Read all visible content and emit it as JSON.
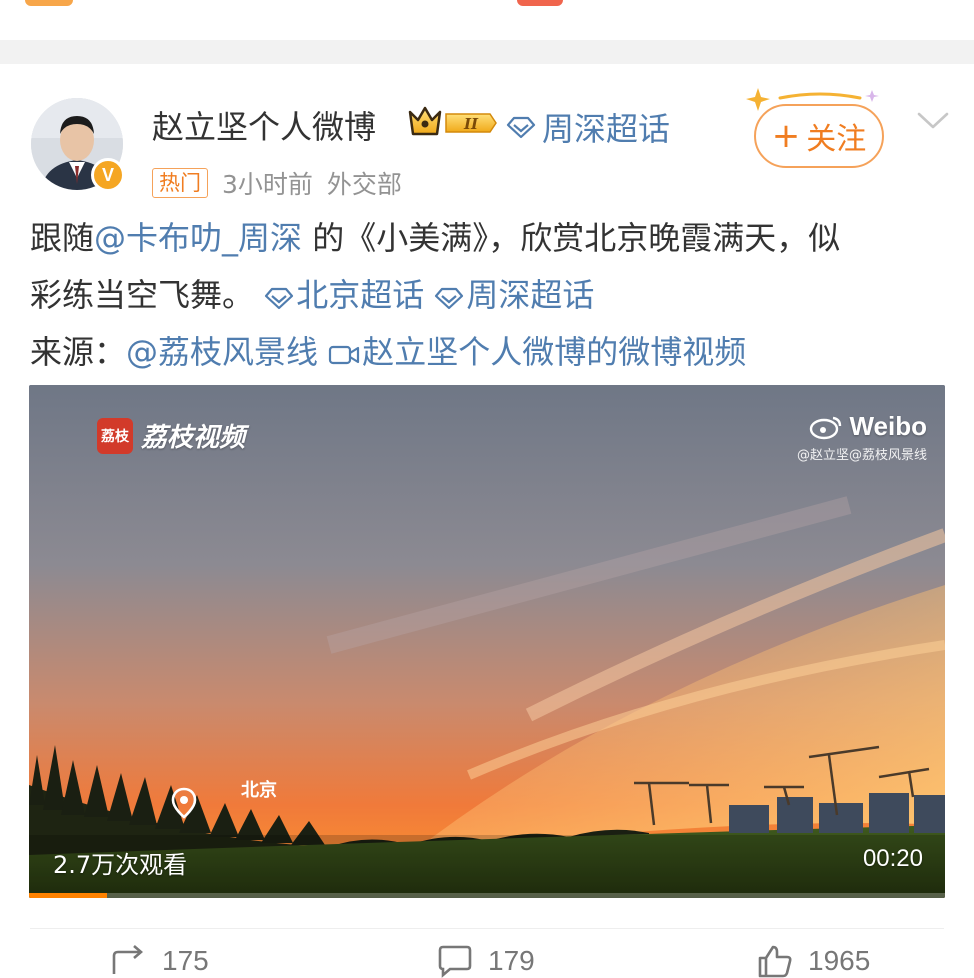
{
  "post": {
    "author_name": "赵立坚个人微博",
    "crown_badge_text": "II",
    "topic_top": "周深超话",
    "follow_label": "关注",
    "follow_plus": "+",
    "meta": {
      "hot_tag": "热门",
      "time": "3小时前",
      "source": "外交部"
    },
    "text_line1_prefix": "跟随",
    "mention_1": "@卡布叻_周深",
    "text_line1_suffix": " 的《小美满》，欣赏北京晚霞满天，似",
    "text_line2": "彩练当空飞舞。",
    "topic_1": "北京超话",
    "topic_2": "周深超话",
    "source_label": "来源：",
    "source_mention": "@荔枝风景线",
    "video_link_text": "赵立坚个人微博的微博视频"
  },
  "video": {
    "watermark_left": "荔枝视频",
    "watermark_logo_text": "荔枝",
    "watermark_right_brand": "Weibo",
    "watermark_right_sub": "@赵立坚@荔枝风景线",
    "location": "北京",
    "views": "2.7万次观看",
    "duration": "00:20",
    "progress_fraction": 0.085
  },
  "actions": {
    "repost": "175",
    "comment": "179",
    "like": "1965"
  },
  "colors": {
    "link": "#507daf",
    "accent": "#f07d21",
    "progress": "#ff8200"
  },
  "icons": [
    "avatar",
    "verified-v-icon",
    "crown-badge-icon",
    "super-topic-icon",
    "follow-sparkle-icon",
    "chevron-down-icon",
    "video-link-icon",
    "location-pin-icon",
    "weibo-logo-icon",
    "repost-icon",
    "comment-icon",
    "like-icon"
  ]
}
